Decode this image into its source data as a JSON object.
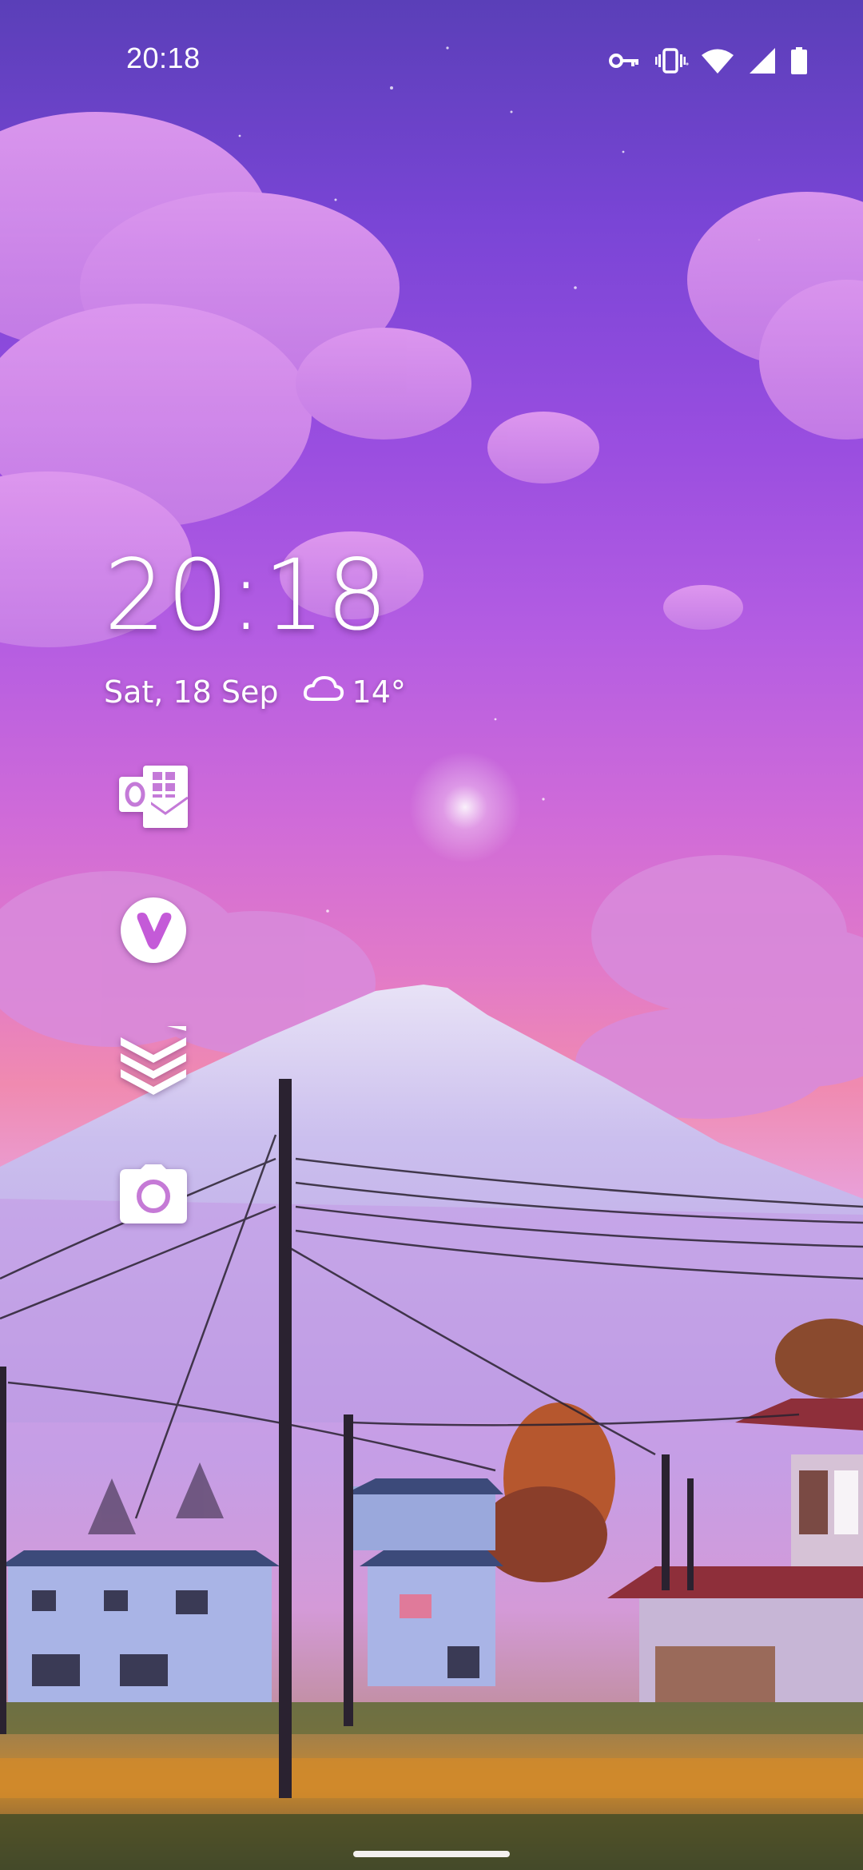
{
  "status_bar": {
    "time": "20:18",
    "icons": [
      "vpn-key-icon",
      "vibrate-icon",
      "wifi-icon",
      "cell-signal-icon",
      "battery-icon"
    ]
  },
  "clock_widget": {
    "time": "20:18",
    "date": "Sat, 18 Sep",
    "weather_icon": "cloud-icon",
    "temperature": "14°"
  },
  "shortcuts": [
    {
      "icon": "outlook-icon",
      "app": "Outlook"
    },
    {
      "icon": "vivaldi-icon",
      "app": "Vivaldi"
    },
    {
      "icon": "layers-icon",
      "app": "Layers"
    },
    {
      "icon": "camera-icon",
      "app": "Camera"
    }
  ],
  "colors": {
    "sky_top": "#5a3fb8",
    "sky_mid": "#d06bd8",
    "horizon": "#f08ab0",
    "foreground_text": "#ffffff"
  }
}
